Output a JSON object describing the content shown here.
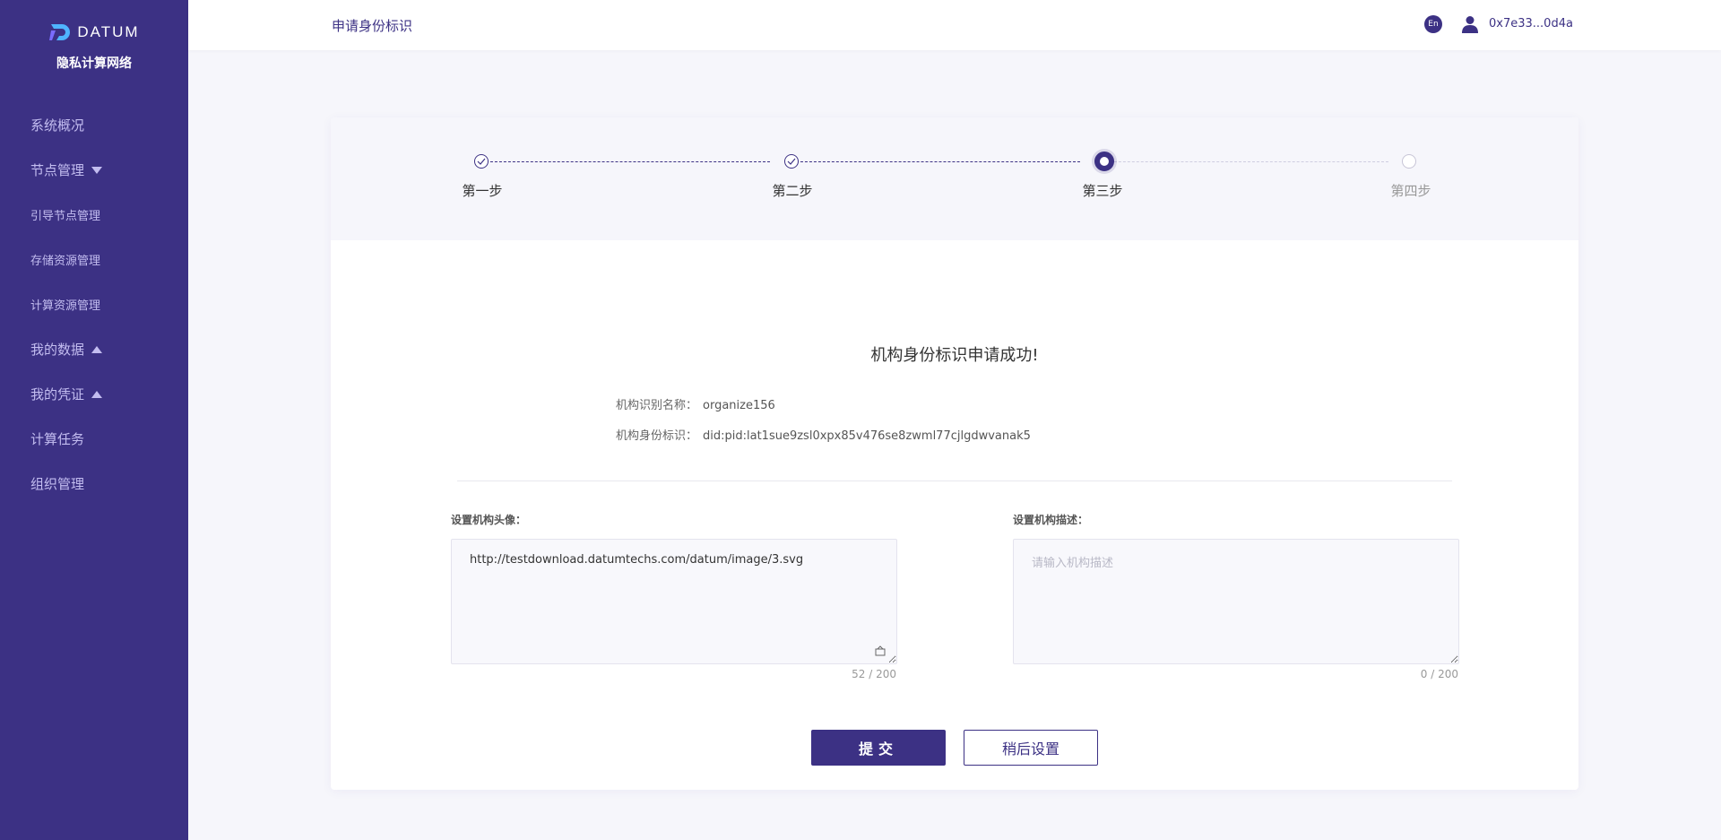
{
  "brand": {
    "logo_text": "DATUM",
    "product_name": "隐私计算网络",
    "accent": "#3c3184"
  },
  "sidebar": {
    "items": [
      {
        "label": "系统概况",
        "caret": ""
      },
      {
        "label": "节点管理",
        "caret": "down"
      },
      {
        "label": "引导节点管理",
        "caret": ""
      },
      {
        "label": "存储资源管理",
        "caret": ""
      },
      {
        "label": "计算资源管理",
        "caret": ""
      },
      {
        "label": "我的数据",
        "caret": "up"
      },
      {
        "label": "我的凭证",
        "caret": "up"
      },
      {
        "label": "计算任务",
        "caret": ""
      },
      {
        "label": "组织管理",
        "caret": ""
      }
    ]
  },
  "header": {
    "title": "申请身份标识",
    "lang_label": "En",
    "user_icon": "user-icon",
    "address": "0x7e33...0d4a"
  },
  "steps": [
    {
      "label": "第一步",
      "status": "done"
    },
    {
      "label": "第二步",
      "status": "done"
    },
    {
      "label": "第三步",
      "status": "current"
    },
    {
      "label": "第四步",
      "status": "todo"
    }
  ],
  "result": {
    "title": "机构身份标识申请成功!",
    "org_name_key": "机构识别名称：",
    "org_name_value": "organize156",
    "org_id_key": "机构身份标识：",
    "org_id_value": "did:pid:lat1sue9zsl0xpx85v476se8zwml77cjlgdwvanak5"
  },
  "form": {
    "avatar_label": "设置机构头像：",
    "avatar_value": "http://testdownload.datumtechs.com/datum/image/3.svg",
    "avatar_counter": "52 / 200",
    "desc_label": "设置机构描述：",
    "desc_placeholder": "请输入机构描述",
    "desc_counter": "0 / 200"
  },
  "buttons": {
    "submit": "提交",
    "later": "稍后设置"
  }
}
